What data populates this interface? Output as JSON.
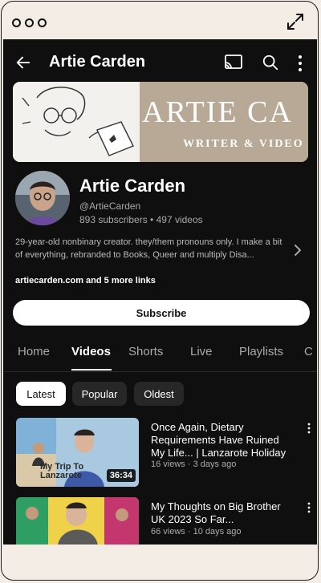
{
  "app": {
    "title": "Artie Carden"
  },
  "banner": {
    "name": "ARTIE CA",
    "tagline": "WRITER & VIDEO"
  },
  "channel": {
    "name": "Artie Carden",
    "handle": "@ArtieCarden",
    "subscribers": "893 subscribers",
    "separator": " • ",
    "videos": "497 videos",
    "about": "29-year-old nonbinary creator. they/them pronouns only. I make a bit of everything, rebranded to Books, Queer and multiply Disa...",
    "links": "artiecarden.com and 5 more links",
    "subscribe_label": "Subscribe"
  },
  "tabs": [
    {
      "label": "Home"
    },
    {
      "label": "Videos"
    },
    {
      "label": "Shorts"
    },
    {
      "label": "Live"
    },
    {
      "label": "Playlists"
    },
    {
      "label": "C"
    }
  ],
  "chips": [
    {
      "label": "Latest"
    },
    {
      "label": "Popular"
    },
    {
      "label": "Oldest"
    }
  ],
  "videos": [
    {
      "title": "Once Again, Dietary Requirements Have Ruined My Life... | Lanzarote Holiday",
      "meta": "16 views · 3 days ago",
      "duration": "36:34",
      "thumb_text": "My Trip To Lanzarote"
    },
    {
      "title": "My Thoughts on Big Brother UK 2023 So Far...",
      "meta": "66 views · 10 days ago"
    }
  ],
  "colors": {
    "background": "#0f0f0f",
    "frame": "#f4ede6",
    "text_secondary": "#aaaaaa"
  },
  "icons": [
    "back-arrow-icon",
    "cast-icon",
    "search-icon",
    "more-vert-icon",
    "expand-icon",
    "chevron-right-icon"
  ]
}
